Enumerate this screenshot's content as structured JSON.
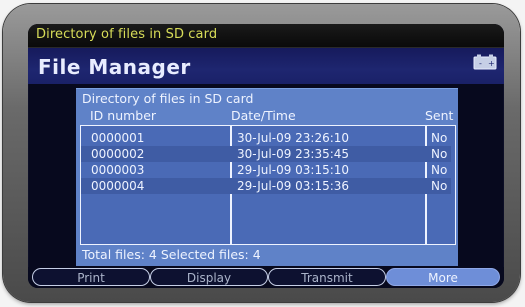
{
  "window": {
    "title": "Directory of files in SD card"
  },
  "app": {
    "title": "File Manager"
  },
  "panel": {
    "title": "Directory of files in SD card",
    "columns": [
      "ID number",
      "Date/Time",
      "Sent"
    ],
    "rows": [
      {
        "id": "0000001",
        "datetime": "30-Jul-09 23:26:10",
        "sent": "No"
      },
      {
        "id": "0000002",
        "datetime": "30-Jul-09 23:35:45",
        "sent": "No"
      },
      {
        "id": "0000003",
        "datetime": "29-Jul-09 03:15:10",
        "sent": "No"
      },
      {
        "id": "0000004",
        "datetime": "29-Jul-09 03:15:36",
        "sent": "No"
      }
    ],
    "footer": "Total files:  4  Selected files:  4"
  },
  "softkeys": [
    {
      "label": "Print"
    },
    {
      "label": "Display"
    },
    {
      "label": "Transmit"
    },
    {
      "label": "More"
    }
  ],
  "icons": {
    "battery": "battery-icon"
  },
  "colors": {
    "title_text": "#d7dc58",
    "panel": "#5f82c8",
    "screen_bg": "#07091e"
  }
}
